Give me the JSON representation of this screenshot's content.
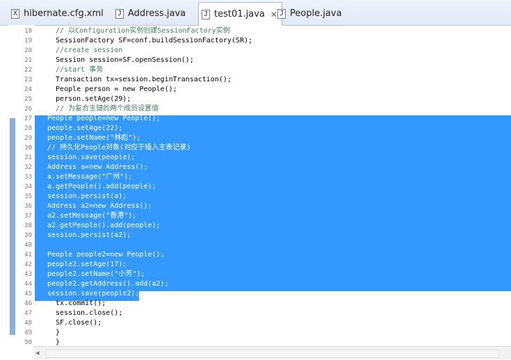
{
  "tabs": [
    {
      "label": "hibernate.cfg.xml",
      "icon": "xml-file-icon",
      "glyph": "X"
    },
    {
      "label": "Address.java",
      "icon": "java-file-icon",
      "glyph": "J"
    },
    {
      "label": "test01.java",
      "icon": "java-file-icon",
      "glyph": "J",
      "active": true,
      "close": "✕"
    },
    {
      "label": "People.java",
      "icon": "java-file-icon",
      "glyph": "J"
    }
  ],
  "editor": {
    "lines": [
      {
        "n": "18",
        "text": "  // 以Configuration实例创建SessionFactory实例"
      },
      {
        "n": "19",
        "text": "  SessionFactory SF=conf.buildSessionFactory(SR);"
      },
      {
        "n": "20",
        "text": "  //create session"
      },
      {
        "n": "21",
        "text": "  Session session=SF.openSession();"
      },
      {
        "n": "22",
        "text": "  //start 事务"
      },
      {
        "n": "23",
        "text": "  Transaction tx=session.beginTransaction();"
      },
      {
        "n": "24",
        "text": "  People person = new People();"
      },
      {
        "n": "25",
        "text": "  person.setAge(29);"
      },
      {
        "n": "26",
        "text": "  // 为复合主键的两个成员设置值"
      },
      {
        "n": "27",
        "text": "People people=new People();"
      },
      {
        "n": "28",
        "text": "people.setAge(22);"
      },
      {
        "n": "29",
        "text": "people.setName(\"林彪\");"
      },
      {
        "n": "30",
        "text": "// 持久化People对象(对应于插入主表记录)"
      },
      {
        "n": "31",
        "text": "session.save(people);"
      },
      {
        "n": "32",
        "text": "Address a=new Address();"
      },
      {
        "n": "33",
        "text": "a.setMessage(\"广州\");"
      },
      {
        "n": "34",
        "text": "a.getPeople().add(people);"
      },
      {
        "n": "35",
        "text": "session.persist(a);"
      },
      {
        "n": "36",
        "text": "Address a2=new Address();"
      },
      {
        "n": "37",
        "text": "a2.setMessage(\"香港\");"
      },
      {
        "n": "38",
        "text": "a2.getPeople().add(people);"
      },
      {
        "n": "39",
        "text": "session.persist(a2);"
      },
      {
        "n": "40",
        "text": ""
      },
      {
        "n": "41",
        "text": "People people2=new People();"
      },
      {
        "n": "42",
        "text": "people2.setAge(17);"
      },
      {
        "n": "43",
        "text": "people2.setName(\"小芳\");"
      },
      {
        "n": "44",
        "text": "people2.getAddress().add(a2);"
      },
      {
        "n": "45",
        "text": "session.save(people2);"
      },
      {
        "n": "46",
        "text": "  tx.commit();"
      },
      {
        "n": "47",
        "text": "  session.close();"
      },
      {
        "n": "48",
        "text": "  SF.close();"
      },
      {
        "n": "49",
        "text": "  }"
      },
      {
        "n": "50",
        "text": "  }"
      }
    ],
    "selection": {
      "from": "27",
      "to": "45"
    }
  },
  "colors": {
    "selection": "#3399ff",
    "comment": "#3f7f5f",
    "keyword": "#7f0055"
  }
}
